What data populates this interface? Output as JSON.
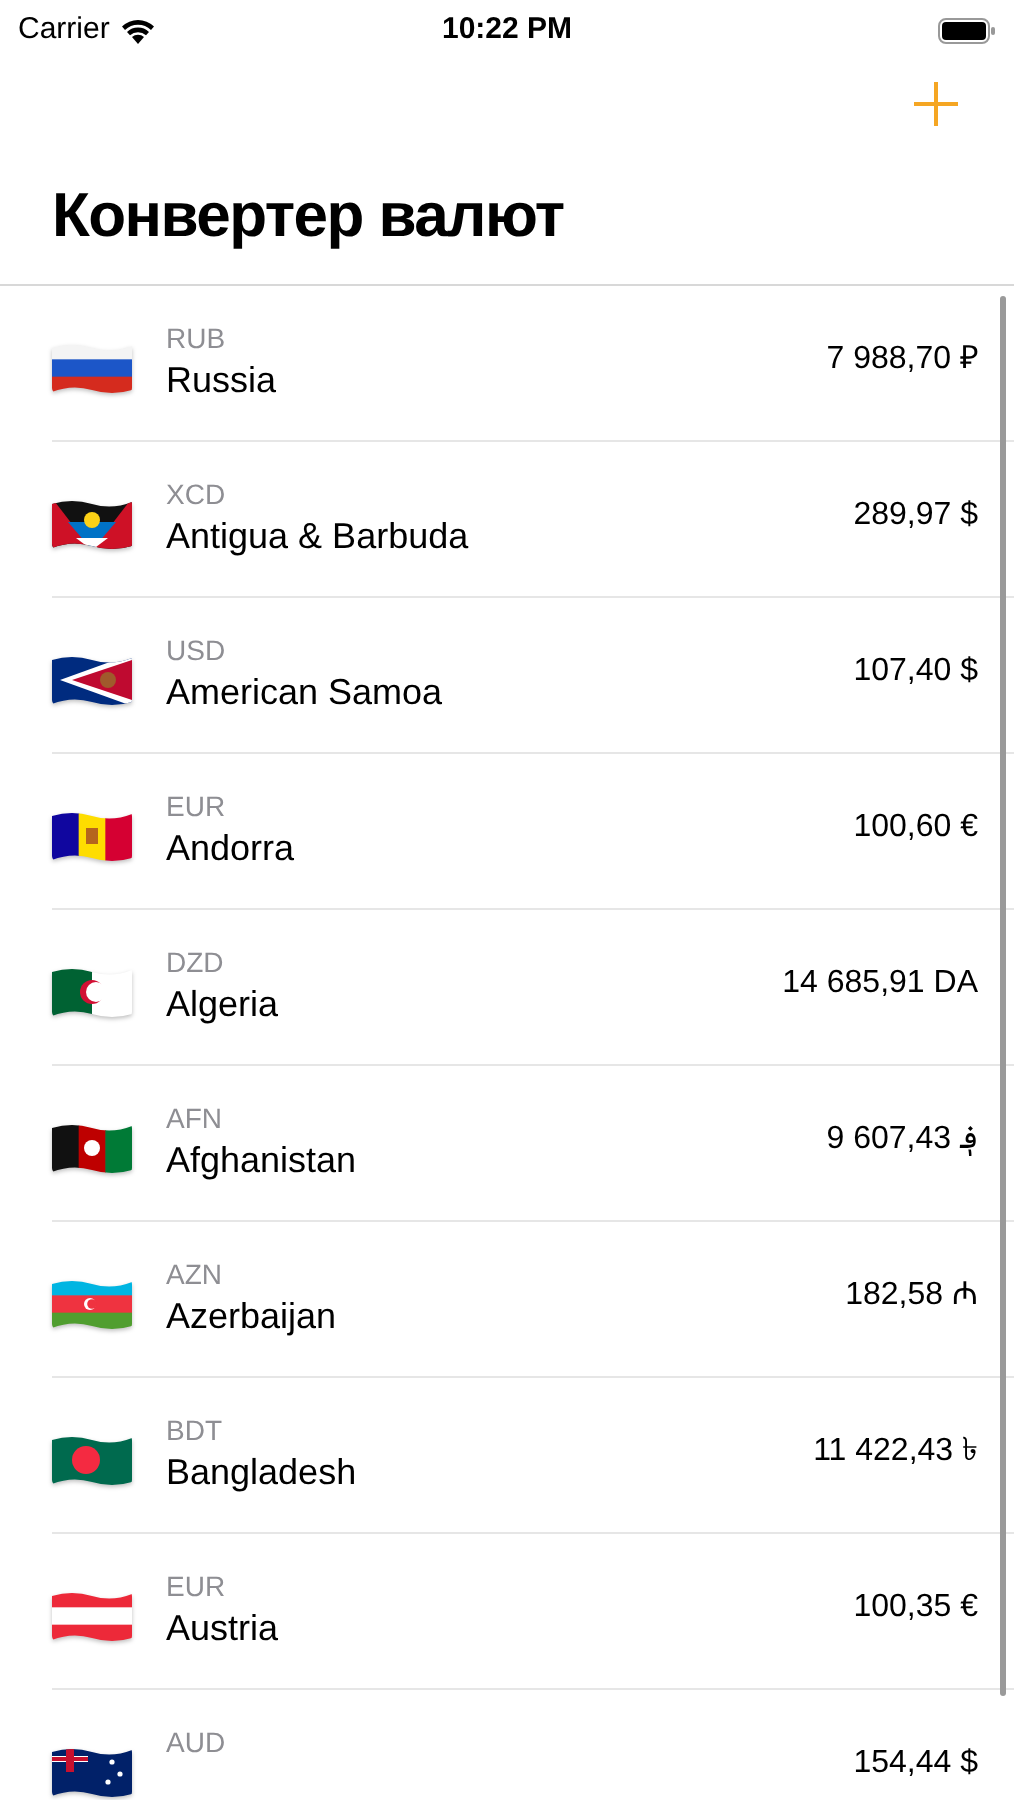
{
  "status_bar": {
    "carrier": "Carrier",
    "time": "10:22 PM"
  },
  "title": "Конвертер валют",
  "rows": [
    {
      "code": "RUB",
      "name": "Russia",
      "amount": "7 988,70 ₽"
    },
    {
      "code": "XCD",
      "name": "Antigua & Barbuda",
      "amount": "289,97 $"
    },
    {
      "code": "USD",
      "name": "American Samoa",
      "amount": "107,40 $"
    },
    {
      "code": "EUR",
      "name": "Andorra",
      "amount": "100,60 €"
    },
    {
      "code": "DZD",
      "name": "Algeria",
      "amount": "14 685,91 DA"
    },
    {
      "code": "AFN",
      "name": "Afghanistan",
      "amount": "9 607,43 ؋"
    },
    {
      "code": "AZN",
      "name": "Azerbaijan",
      "amount": "182,58 ₼"
    },
    {
      "code": "BDT",
      "name": "Bangladesh",
      "amount": "11 422,43 ৳"
    },
    {
      "code": "EUR",
      "name": "Austria",
      "amount": "100,35 €"
    },
    {
      "code": "AUD",
      "amount": "154,44 $"
    }
  ]
}
